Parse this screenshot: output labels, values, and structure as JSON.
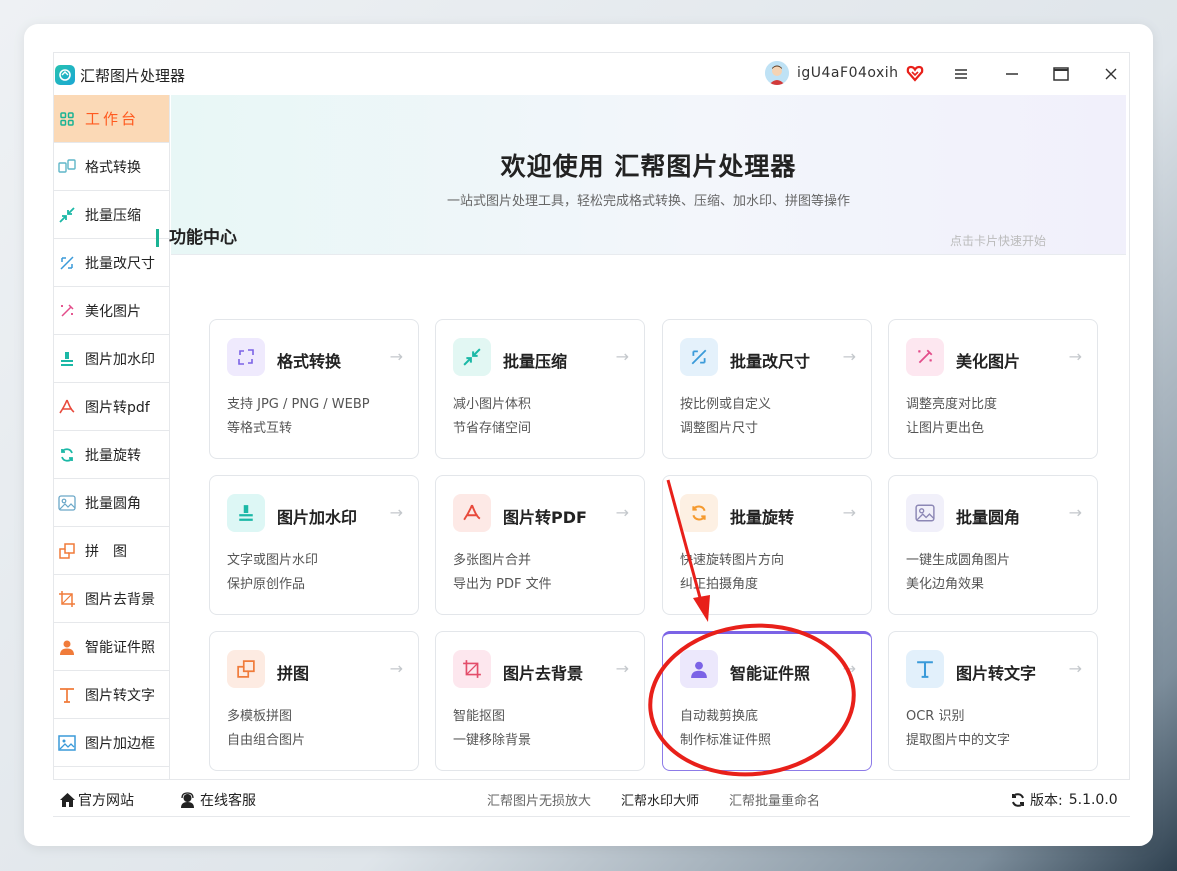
{
  "app": {
    "title": "汇帮图片处理器",
    "username": "igU4aF04oxih"
  },
  "sidebar": {
    "items": [
      {
        "label": "工作台",
        "icon": "grid-icon"
      },
      {
        "label": "格式转换",
        "icon": "format-convert-icon"
      },
      {
        "label": "批量压缩",
        "icon": "compress-icon"
      },
      {
        "label": "批量改尺寸",
        "icon": "resize-icon"
      },
      {
        "label": "美化图片",
        "icon": "beautify-icon"
      },
      {
        "label": "图片加水印",
        "icon": "watermark-icon"
      },
      {
        "label": "图片转pdf",
        "icon": "pdf-icon"
      },
      {
        "label": "批量旋转",
        "icon": "rotate-icon"
      },
      {
        "label": "批量圆角",
        "icon": "round-corner-icon"
      },
      {
        "label": "拼　图",
        "icon": "collage-icon"
      },
      {
        "label": "图片去背景",
        "icon": "crop-icon"
      },
      {
        "label": "智能证件照",
        "icon": "person-icon"
      },
      {
        "label": "图片转文字",
        "icon": "text-icon"
      },
      {
        "label": "图片加边框",
        "icon": "image-frame-icon"
      }
    ]
  },
  "banner": {
    "title": "欢迎使用 汇帮图片处理器",
    "subtitle": "一站式图片处理工具，轻松完成格式转换、压缩、加水印、拼图等操作"
  },
  "section": {
    "title": "功能中心",
    "hint": "点击卡片快速开始"
  },
  "cards": [
    {
      "name": "格式转换",
      "d1": "支持 JPG / PNG / WEBP",
      "d2": "等格式互转",
      "icon": "format-convert-icon"
    },
    {
      "name": "批量压缩",
      "d1": "减小图片体积",
      "d2": "节省存储空间",
      "icon": "compress-icon"
    },
    {
      "name": "批量改尺寸",
      "d1": "按比例或自定义",
      "d2": "调整图片尺寸",
      "icon": "resize-icon"
    },
    {
      "name": "美化图片",
      "d1": "调整亮度对比度",
      "d2": "让图片更出色",
      "icon": "beautify-icon"
    },
    {
      "name": "图片加水印",
      "d1": "文字或图片水印",
      "d2": "保护原创作品",
      "icon": "watermark-icon"
    },
    {
      "name": "图片转PDF",
      "d1": "多张图片合并",
      "d2": "导出为 PDF 文件",
      "icon": "pdf-icon"
    },
    {
      "name": "批量旋转",
      "d1": "快速旋转图片方向",
      "d2": "纠正拍摄角度",
      "icon": "rotate-icon"
    },
    {
      "name": "批量圆角",
      "d1": "一键生成圆角图片",
      "d2": "美化边角效果",
      "icon": "round-corner-icon"
    },
    {
      "name": "拼图",
      "d1": "多模板拼图",
      "d2": "自由组合图片",
      "icon": "collage-icon"
    },
    {
      "name": "图片去背景",
      "d1": "智能抠图",
      "d2": "一键移除背景",
      "icon": "crop-icon"
    },
    {
      "name": "智能证件照",
      "d1": "自动裁剪换底",
      "d2": "制作标准证件照",
      "icon": "person-icon"
    },
    {
      "name": "图片转文字",
      "d1": "OCR 识别",
      "d2": "提取图片中的文字",
      "icon": "text-icon"
    }
  ],
  "footer": {
    "website": "官方网站",
    "support": "在线客服",
    "links": [
      "汇帮图片无损放大",
      "汇帮水印大师",
      "汇帮批量重命名"
    ],
    "version_label": "版本:",
    "version": "5.1.0.0"
  },
  "colors": {
    "accent_orange": "#ff5a1f",
    "accent_teal": "#1ab394",
    "annotation_red": "#e8201a",
    "selected_border": "#7b63e6"
  }
}
